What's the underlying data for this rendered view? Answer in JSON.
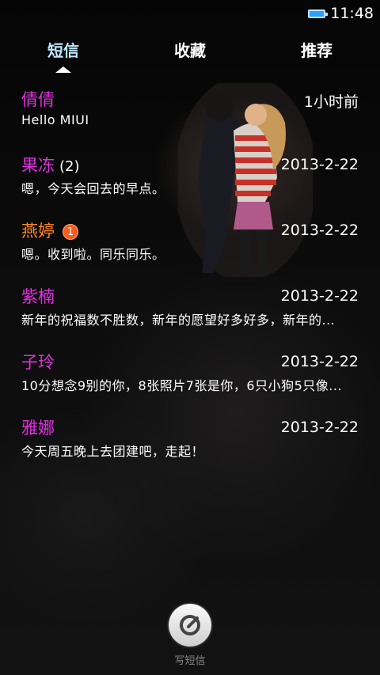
{
  "status_bar": {
    "time": "11:48"
  },
  "tabs": [
    {
      "label": "短信",
      "active": true
    },
    {
      "label": "收藏",
      "active": false
    },
    {
      "label": "推荐",
      "active": false
    }
  ],
  "conversations": [
    {
      "name": "倩倩",
      "date": "1小时前",
      "preview": "Hello MIUI",
      "name_color": "#e030e0"
    },
    {
      "name": "果冻",
      "count": "(2)",
      "date": "2013-2-22",
      "preview": "嗯，今天会回去的早点。",
      "name_color": "#e030e0"
    },
    {
      "name": "燕婷",
      "badge": "1",
      "date": "2013-2-22",
      "preview": "嗯。收到啦。同乐同乐。",
      "name_color": "#ff8a1e"
    },
    {
      "name": "紫楠",
      "date": "2013-2-22",
      "preview": "新年的祝福数不胜数，新年的愿望好多好多，新年的...",
      "name_color": "#e030e0"
    },
    {
      "name": "子玲",
      "date": "2013-2-22",
      "preview": "10分想念9别的你，8张照片7张是你，6只小狗5只像...",
      "name_color": "#e030e0"
    },
    {
      "name": "雅娜",
      "date": "2013-2-22",
      "preview": "今天周五晚上去团建吧，走起！",
      "name_color": "#e030e0"
    }
  ],
  "compose": {
    "label": "写短信",
    "icon": "compose-icon"
  }
}
